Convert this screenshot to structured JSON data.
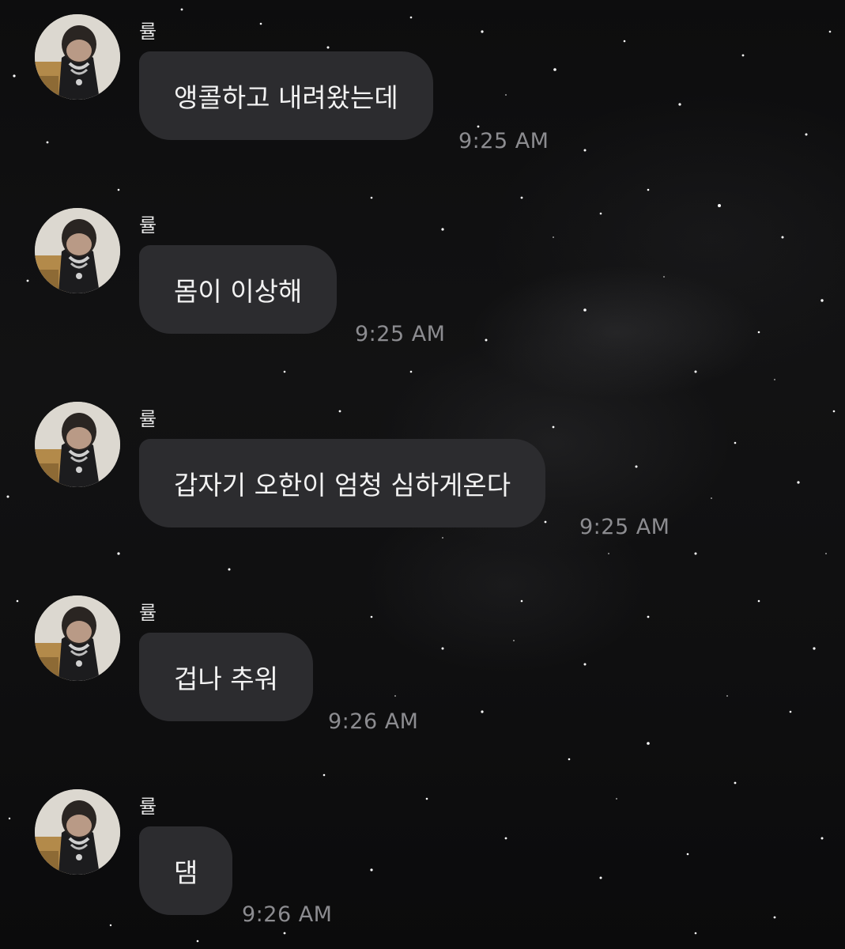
{
  "chat": {
    "messages": [
      {
        "sender": "률",
        "text": "앵콜하고 내려왔는데",
        "time": "9:25 AM"
      },
      {
        "sender": "률",
        "text": "몸이 이상해",
        "time": "9:25 AM"
      },
      {
        "sender": "률",
        "text": "갑자기 오한이 엄청 심하게온다",
        "time": "9:25 AM"
      },
      {
        "sender": "률",
        "text": "겁나 추워",
        "time": "9:26 AM"
      },
      {
        "sender": "률",
        "text": "댐",
        "time": "9:26 AM"
      }
    ]
  },
  "colors": {
    "background": "#0b0b0c",
    "bubble": "#2c2c2f",
    "bubble_text": "#f2f2f2",
    "name_text": "#e6e6e6",
    "time_text": "#8c8c90"
  }
}
